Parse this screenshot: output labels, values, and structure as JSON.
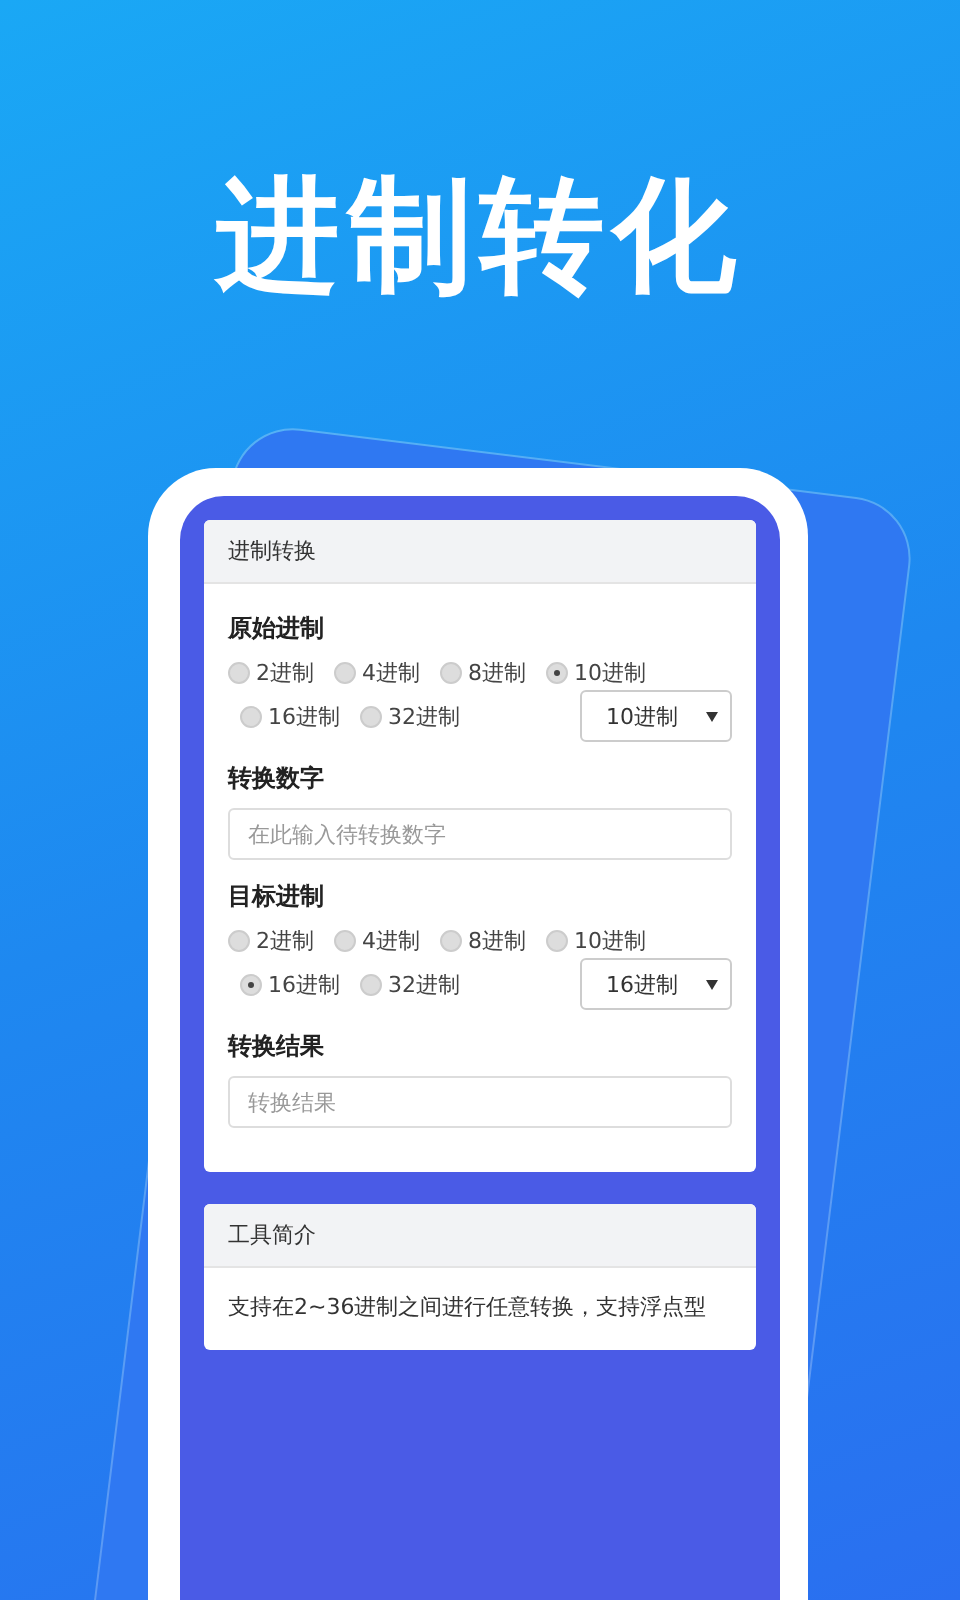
{
  "hero_title": "进制转化",
  "panel": {
    "title": "进制转换",
    "source": {
      "label": "原始进制",
      "options": [
        {
          "label": "2进制",
          "selected": false
        },
        {
          "label": "4进制",
          "selected": false
        },
        {
          "label": "8进制",
          "selected": false
        },
        {
          "label": "10进制",
          "selected": true
        },
        {
          "label": "16进制",
          "selected": false
        },
        {
          "label": "32进制",
          "selected": false
        }
      ],
      "dropdown": "10进制"
    },
    "number": {
      "label": "转换数字",
      "placeholder": "在此输入待转换数字"
    },
    "target": {
      "label": "目标进制",
      "options": [
        {
          "label": "2进制",
          "selected": false
        },
        {
          "label": "4进制",
          "selected": false
        },
        {
          "label": "8进制",
          "selected": false
        },
        {
          "label": "10进制",
          "selected": false
        },
        {
          "label": "16进制",
          "selected": true
        },
        {
          "label": "32进制",
          "selected": false
        }
      ],
      "dropdown": "16进制"
    },
    "result": {
      "label": "转换结果",
      "placeholder": "转换结果"
    }
  },
  "intro": {
    "title": "工具简介",
    "text": "支持在2~36进制之间进行任意转换，支持浮点型"
  }
}
